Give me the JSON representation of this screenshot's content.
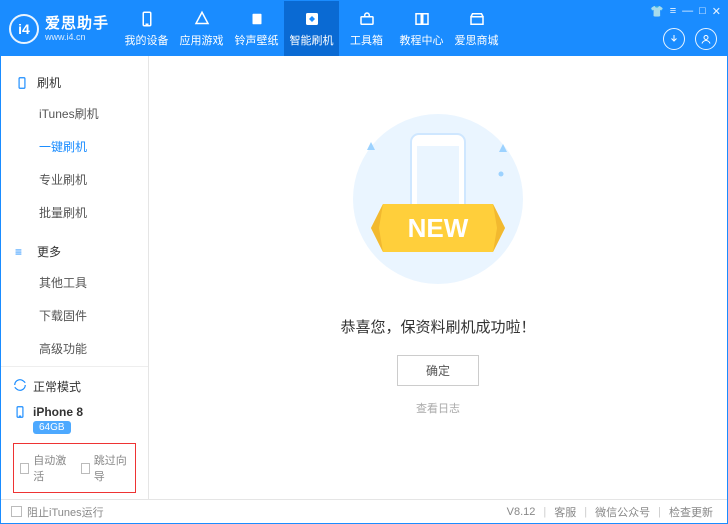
{
  "logo": {
    "title": "爱思助手",
    "url": "www.i4.cn"
  },
  "nav": [
    {
      "label": "我的设备"
    },
    {
      "label": "应用游戏"
    },
    {
      "label": "铃声壁纸"
    },
    {
      "label": "智能刷机"
    },
    {
      "label": "工具箱"
    },
    {
      "label": "教程中心"
    },
    {
      "label": "爱思商城"
    }
  ],
  "sidebar": {
    "groups": [
      {
        "title": "刷机",
        "items": [
          "iTunes刷机",
          "一键刷机",
          "专业刷机",
          "批量刷机"
        ]
      },
      {
        "title": "更多",
        "items": [
          "其他工具",
          "下载固件",
          "高级功能"
        ]
      }
    ],
    "mode": "正常模式",
    "device": "iPhone 8",
    "storage": "64GB",
    "auto_activate": "自动激活",
    "skip_guide": "跳过向导"
  },
  "main": {
    "banner": "NEW",
    "message": "恭喜您，保资料刷机成功啦！",
    "confirm": "确定",
    "view_log": "查看日志"
  },
  "footer": {
    "block_itunes": "阻止iTunes运行",
    "version": "V8.12",
    "support": "客服",
    "wechat": "微信公众号",
    "update": "检查更新"
  }
}
